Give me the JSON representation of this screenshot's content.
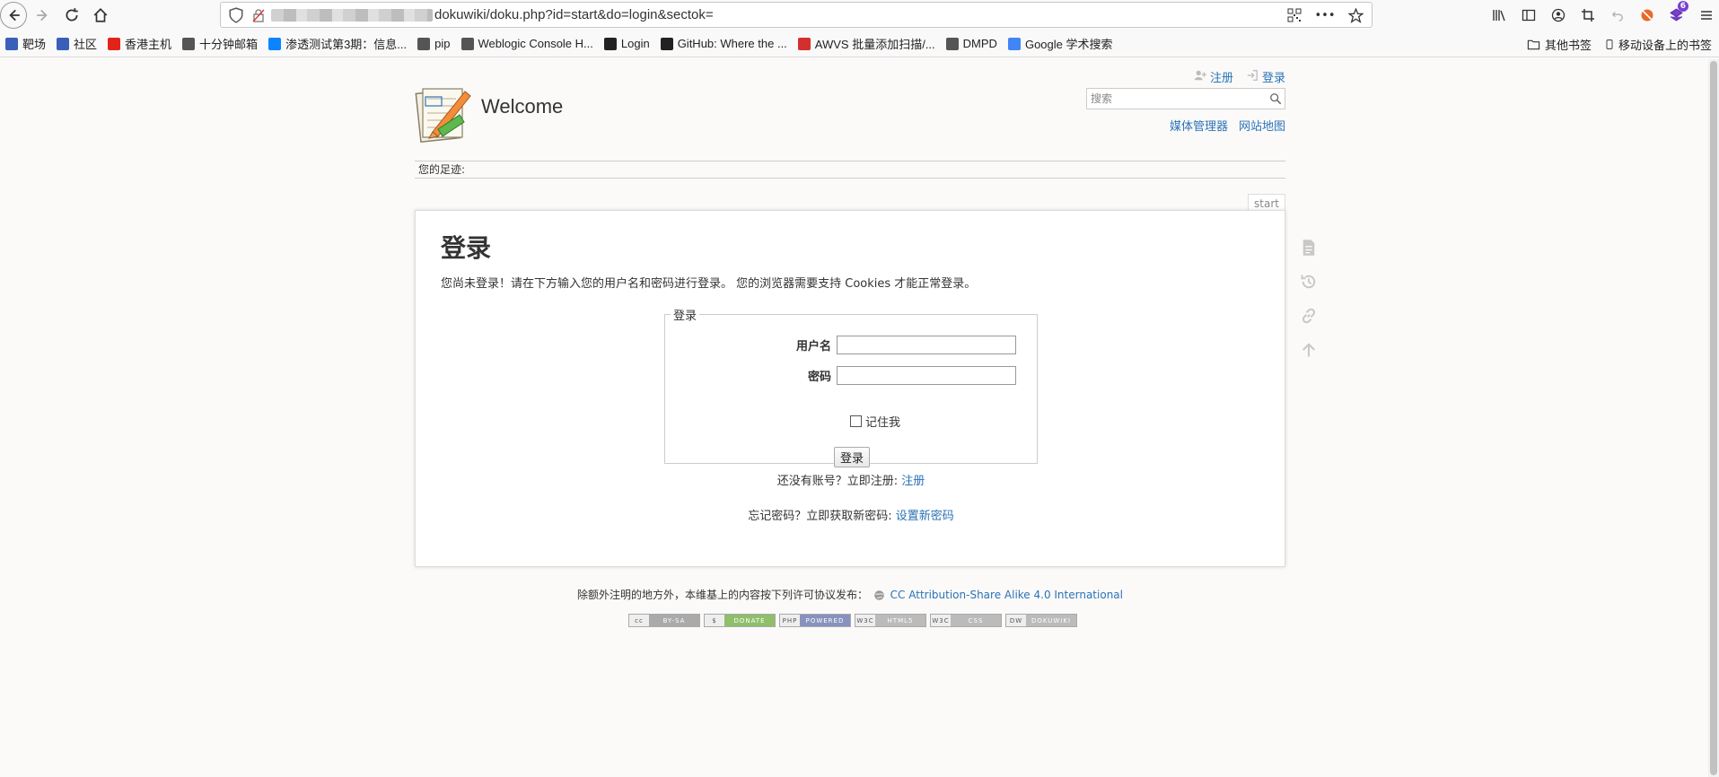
{
  "browser": {
    "url": "dokuwiki/doku.php?id=start&do=login&sectok=",
    "bookmarks": [
      {
        "label": "靶场",
        "icon": "shield-icon",
        "color": "#3a5fb8"
      },
      {
        "label": "社区",
        "icon": "shield-icon",
        "color": "#3a5fb8"
      },
      {
        "label": "香港主机",
        "icon": "cloud-icon",
        "color": "#e2231a"
      },
      {
        "label": "十分钟邮箱",
        "icon": "globe-icon",
        "color": "#555555"
      },
      {
        "label": "渗透测试第3期：信息...",
        "icon": "zhihu-icon",
        "color": "#0a84ff"
      },
      {
        "label": "pip",
        "icon": "globe-icon",
        "color": "#555555"
      },
      {
        "label": "Weblogic Console H...",
        "icon": "weblogic-icon",
        "color": "#555555"
      },
      {
        "label": "Login",
        "icon": "login-icon",
        "color": "#222222"
      },
      {
        "label": "GitHub: Where the ...",
        "icon": "github-icon",
        "color": "#222222"
      },
      {
        "label": "AWVS 批量添加扫描/...",
        "icon": "awvs-icon",
        "color": "#d32f2f"
      },
      {
        "label": "DMPD",
        "icon": "image-icon",
        "color": "#555555"
      },
      {
        "label": "Google 学术搜索",
        "icon": "scholar-icon",
        "color": "#4285f4"
      }
    ],
    "other_bookmarks": "其他书签",
    "mobile_bookmarks": "移动设备上的书签",
    "extension_badge": "6"
  },
  "header": {
    "site_title": "Welcome",
    "register_label": "注册",
    "login_label": "登录",
    "search_placeholder": "搜索",
    "media_manager": "媒体管理器",
    "sitemap": "网站地图"
  },
  "breadcrumbs": {
    "label": "您的足迹:"
  },
  "page_id": "start",
  "content": {
    "title": "登录",
    "intro": "您尚未登录！请在下方输入您的用户名和密码进行登录。 您的浏览器需要支持 Cookies 才能正常登录。",
    "legend": "登录",
    "username_label": "用户名",
    "username_value": "",
    "password_label": "密码",
    "password_value": "",
    "remember_label": "记住我",
    "login_button": "登录",
    "no_account_text": "还没有账号？立即注册:",
    "register_link": "注册",
    "forgot_text": "忘记密码？立即获取新密码:",
    "reset_link": "设置新密码"
  },
  "footer": {
    "license_text": "除额外注明的地方外，本维基上的内容按下列许可协议发布：",
    "license_link": "CC Attribution-Share Alike 4.0 International",
    "badges": [
      {
        "left": "cc",
        "right": "BY-SA",
        "color": "#aaaaaa"
      },
      {
        "left": "$",
        "right": "DONATE",
        "color": "#8fbf6a"
      },
      {
        "left": "PHP",
        "right": "POWERED",
        "color": "#8892bf"
      },
      {
        "left": "W3C",
        "right": "HTML5",
        "color": "#bbbbbb"
      },
      {
        "left": "W3C",
        "right": "CSS",
        "color": "#bbbbbb"
      },
      {
        "left": "DW",
        "right": "DOKUWIKI",
        "color": "#bbbbbb"
      }
    ]
  }
}
